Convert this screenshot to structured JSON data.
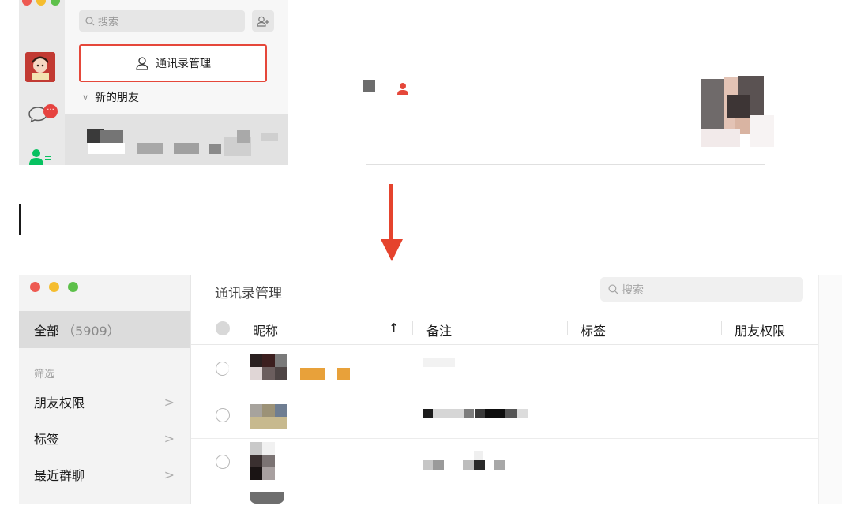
{
  "top_panel": {
    "search_placeholder": "搜索",
    "manage_button_label": "通讯录管理",
    "new_friends_label": "新的朋友",
    "unread_badge": "···"
  },
  "manage_window": {
    "title": "通讯录管理",
    "search_placeholder": "搜索",
    "sidebar": {
      "all_label": "全部",
      "all_count": "（5909）",
      "filter_section": "筛选",
      "items": [
        {
          "label": "朋友权限",
          "chevron": ">"
        },
        {
          "label": "标签",
          "chevron": ">"
        },
        {
          "label": "最近群聊",
          "chevron": ">"
        }
      ]
    },
    "table": {
      "columns": [
        "昵称",
        "备注",
        "标签",
        "朋友权限"
      ],
      "sort_indicator": "↑"
    }
  },
  "colors": {
    "accent_red": "#e5473a",
    "arrow_red": "#e5432d",
    "badge_red": "#e64340",
    "contacts_green": "#07c160"
  }
}
